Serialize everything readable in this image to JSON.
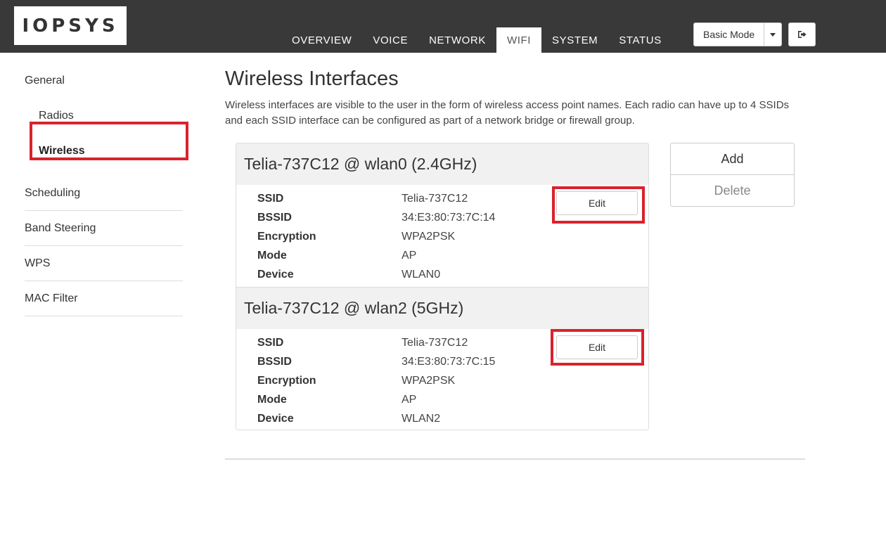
{
  "brand": {
    "logo_text": "IOPSYS"
  },
  "nav": {
    "tabs": [
      {
        "label": "OVERVIEW"
      },
      {
        "label": "VOICE"
      },
      {
        "label": "NETWORK"
      },
      {
        "label": "WIFI",
        "active": true
      },
      {
        "label": "SYSTEM"
      },
      {
        "label": "STATUS"
      }
    ],
    "mode_label": "Basic Mode",
    "logout_icon": "logout-icon"
  },
  "sidebar": {
    "items": [
      {
        "label": "General"
      },
      {
        "label": "Radios"
      },
      {
        "label": "Wireless",
        "active": true
      },
      {
        "label": "Scheduling"
      },
      {
        "label": "Band Steering"
      },
      {
        "label": "WPS"
      },
      {
        "label": "MAC Filter"
      }
    ]
  },
  "main": {
    "title": "Wireless Interfaces",
    "description": "Wireless interfaces are visible to the user in the form of wireless access point names. Each radio can have up to 4 SSIDs and each SSID interface can be configured as part of a network bridge or firewall group.",
    "interfaces": [
      {
        "header": "Telia-737C12 @ wlan0 (2.4GHz)",
        "fields": [
          {
            "label": "SSID",
            "value": "Telia-737C12"
          },
          {
            "label": "BSSID",
            "value": "34:E3:80:73:7C:14"
          },
          {
            "label": "Encryption",
            "value": "WPA2PSK"
          },
          {
            "label": "Mode",
            "value": "AP"
          },
          {
            "label": "Device",
            "value": "WLAN0"
          }
        ],
        "edit_label": "Edit"
      },
      {
        "header": "Telia-737C12 @ wlan2 (5GHz)",
        "fields": [
          {
            "label": "SSID",
            "value": "Telia-737C12"
          },
          {
            "label": "BSSID",
            "value": "34:E3:80:73:7C:15"
          },
          {
            "label": "Encryption",
            "value": "WPA2PSK"
          },
          {
            "label": "Mode",
            "value": "AP"
          },
          {
            "label": "Device",
            "value": "WLAN2"
          }
        ],
        "edit_label": "Edit"
      }
    ],
    "actions": {
      "add_label": "Add",
      "delete_label": "Delete"
    }
  },
  "colors": {
    "header_bg": "#393939",
    "highlight": "#d9232d"
  }
}
